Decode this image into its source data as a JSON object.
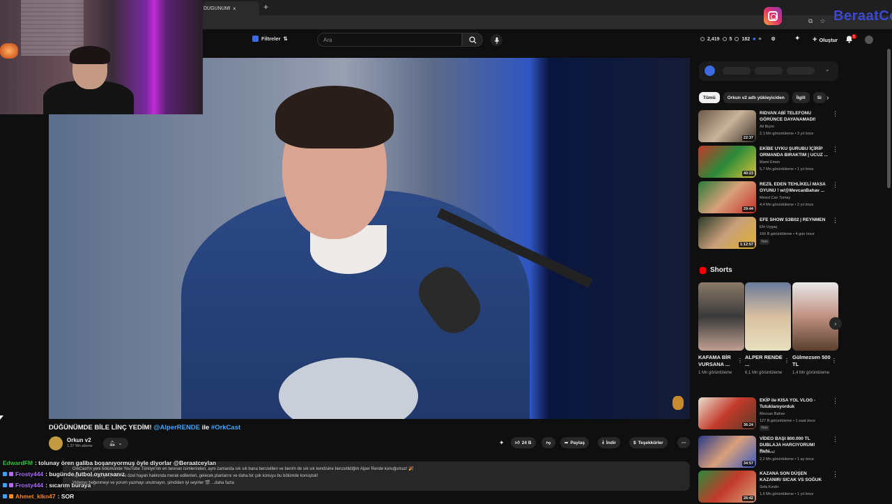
{
  "browser": {
    "tab_title": "DÜĞÜNÜMDE BİLE LİNÇ YE",
    "tab_close": "×",
    "new_tab": "+"
  },
  "overlay": {
    "brand_text": "BeraatCe"
  },
  "header": {
    "filter_label": "Filtreler",
    "search_placeholder": "Ara",
    "stats": [
      "2,419",
      "5",
      "182"
    ],
    "create_label": "Oluştur",
    "notification_count": "5"
  },
  "video": {
    "title_main": "DÜĞÜNÜMDE BİLE LİNÇ YEDİM!",
    "title_mention": "@AlperRENDE",
    "title_connector": "ile",
    "title_hashtag": "#OrkCast",
    "channel_name": "Orkun v2",
    "channel_subs": "1,37 Mn abone",
    "likes": "24 B",
    "share_label": "Paylaş",
    "download_label": "İndir",
    "thanks_label": "Teşekkürler",
    "description_line1": "OrkCast'in yeni bölümünde YouTube Türkiye'nin en tanınan isimlerinden, aynı zamanda sık sık bana benzetilen ve benim de sık sık kendisine benzetildiğim Alper Rende konuğumuz! 🎉",
    "description_line2": "Alper'le hem kariyeri, hem de özel hayatı hakkında merak edilenleri, gelecek planlarını ve daha bir çok konuyu bu bölümde konuştuk!",
    "description_line3": "Videoyu beğenmeyi ve yorum yazmayı unutmayın, şimdiden iyi seyirler 🎬 ...daha fazla"
  },
  "chat": [
    {
      "user": "EdwardFM",
      "color": "#2ecc40",
      "message": ": tolunay ören galiba boşanıyormuş öyle diyorlar @Beraatceylan"
    },
    {
      "user": "Frosty444",
      "color": "#b06cff",
      "message": ": bugünde futbol oynarsanız"
    },
    {
      "user": "Frosty444",
      "color": "#b06cff",
      "message": ": sıcarım buraya"
    },
    {
      "user": "Ahmet_klkn47",
      "color": "#ff8c1a",
      "message": ": SOR"
    }
  ],
  "sidebar": {
    "chips": [
      "Tümü",
      "Orkun v2 adlı yükleyiciden",
      "İlgili",
      "Si"
    ],
    "videos_top": [
      {
        "title": "RIDVAN ABİ TELEFONU GÖRÜNCE DAYANAMADI!",
        "channel": "Ali Biçim",
        "meta": "2,1 Mn görüntüleme • 3 yıl önce",
        "duration": "22:37",
        "badge": ""
      },
      {
        "title": "EKİBE UYKU ŞURUBU İÇİRİP ORMANDA BIRAKTIM | UCUZ ...",
        "channel": "Mami Emen",
        "meta": "5,7 Mn görüntüleme • 1 yıl önce",
        "duration": "40:23",
        "badge": ""
      },
      {
        "title": "REZİL EDEN TEHLİKELİ MASA OYUNU ! w/@MevcanBahav ...",
        "channel": "Mesut Can Tomay",
        "meta": "4,4 Mn görüntüleme • 2 yıl önce",
        "duration": "29:44",
        "badge": ""
      },
      {
        "title": "EFE SHOW S3B02 | REYNMEN",
        "channel": "Efe Uygaç",
        "meta": "166 B görüntüleme • 4 gün önce",
        "duration": "1:12:57",
        "badge": "Yeni"
      }
    ],
    "shorts_label": "Shorts",
    "shorts": [
      {
        "title": "KAFAMA BİR VURSANA ...",
        "views": "1 Mn görüntüleme"
      },
      {
        "title": "ALPER RENDE ...",
        "views": "6,1 Mn görüntüleme"
      },
      {
        "title": "Gülmezsen 500 TL",
        "views": "1,4 Mn görüntüleme"
      }
    ],
    "videos_bottom": [
      {
        "title": "EKİP ile KISA YOL VLOG - Tutuklanıyorduk",
        "channel": "Mevcan Bahav",
        "meta": "127 B görüntüleme • 1 saat önce",
        "duration": "36:24",
        "badge": "Yeni"
      },
      {
        "title": "VİDEO BAŞI 800.000 TL DUBLAJA HARCIYORUM! Ruhi...",
        "channel": "Orkun v2",
        "meta": "2,2 Mn görüntüleme • 1 ay önce",
        "duration": "34:57",
        "badge": ""
      },
      {
        "title": "KAZANA SON DÜŞEN KAZANIR/ SICAK VS SOĞUK",
        "channel": "Sefa Kındır",
        "meta": "1,6 Mn görüntüleme • 1 yıl önce",
        "duration": "26:42",
        "badge": ""
      }
    ]
  }
}
